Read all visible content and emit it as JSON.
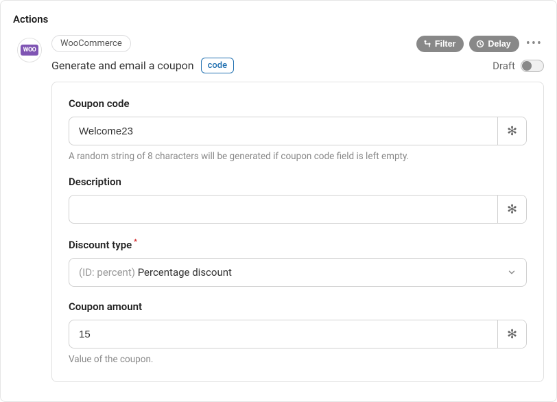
{
  "section_title": "Actions",
  "app": {
    "name": "WooCommerce",
    "badge": "WOO"
  },
  "top_actions": {
    "filter_label": "Filter",
    "delay_label": "Delay"
  },
  "action": {
    "title": "Generate and email a coupon",
    "code_tag": "code",
    "status_label": "Draft"
  },
  "fields": {
    "coupon_code": {
      "label": "Coupon code",
      "value": "Welcome23",
      "help": "A random string of 8 characters will be generated if coupon code field is left empty."
    },
    "description": {
      "label": "Description",
      "value": ""
    },
    "discount_type": {
      "label": "Discount type",
      "prefix": "(ID: percent)",
      "value": "Percentage discount"
    },
    "coupon_amount": {
      "label": "Coupon amount",
      "value": "15",
      "help": "Value of the coupon."
    }
  }
}
